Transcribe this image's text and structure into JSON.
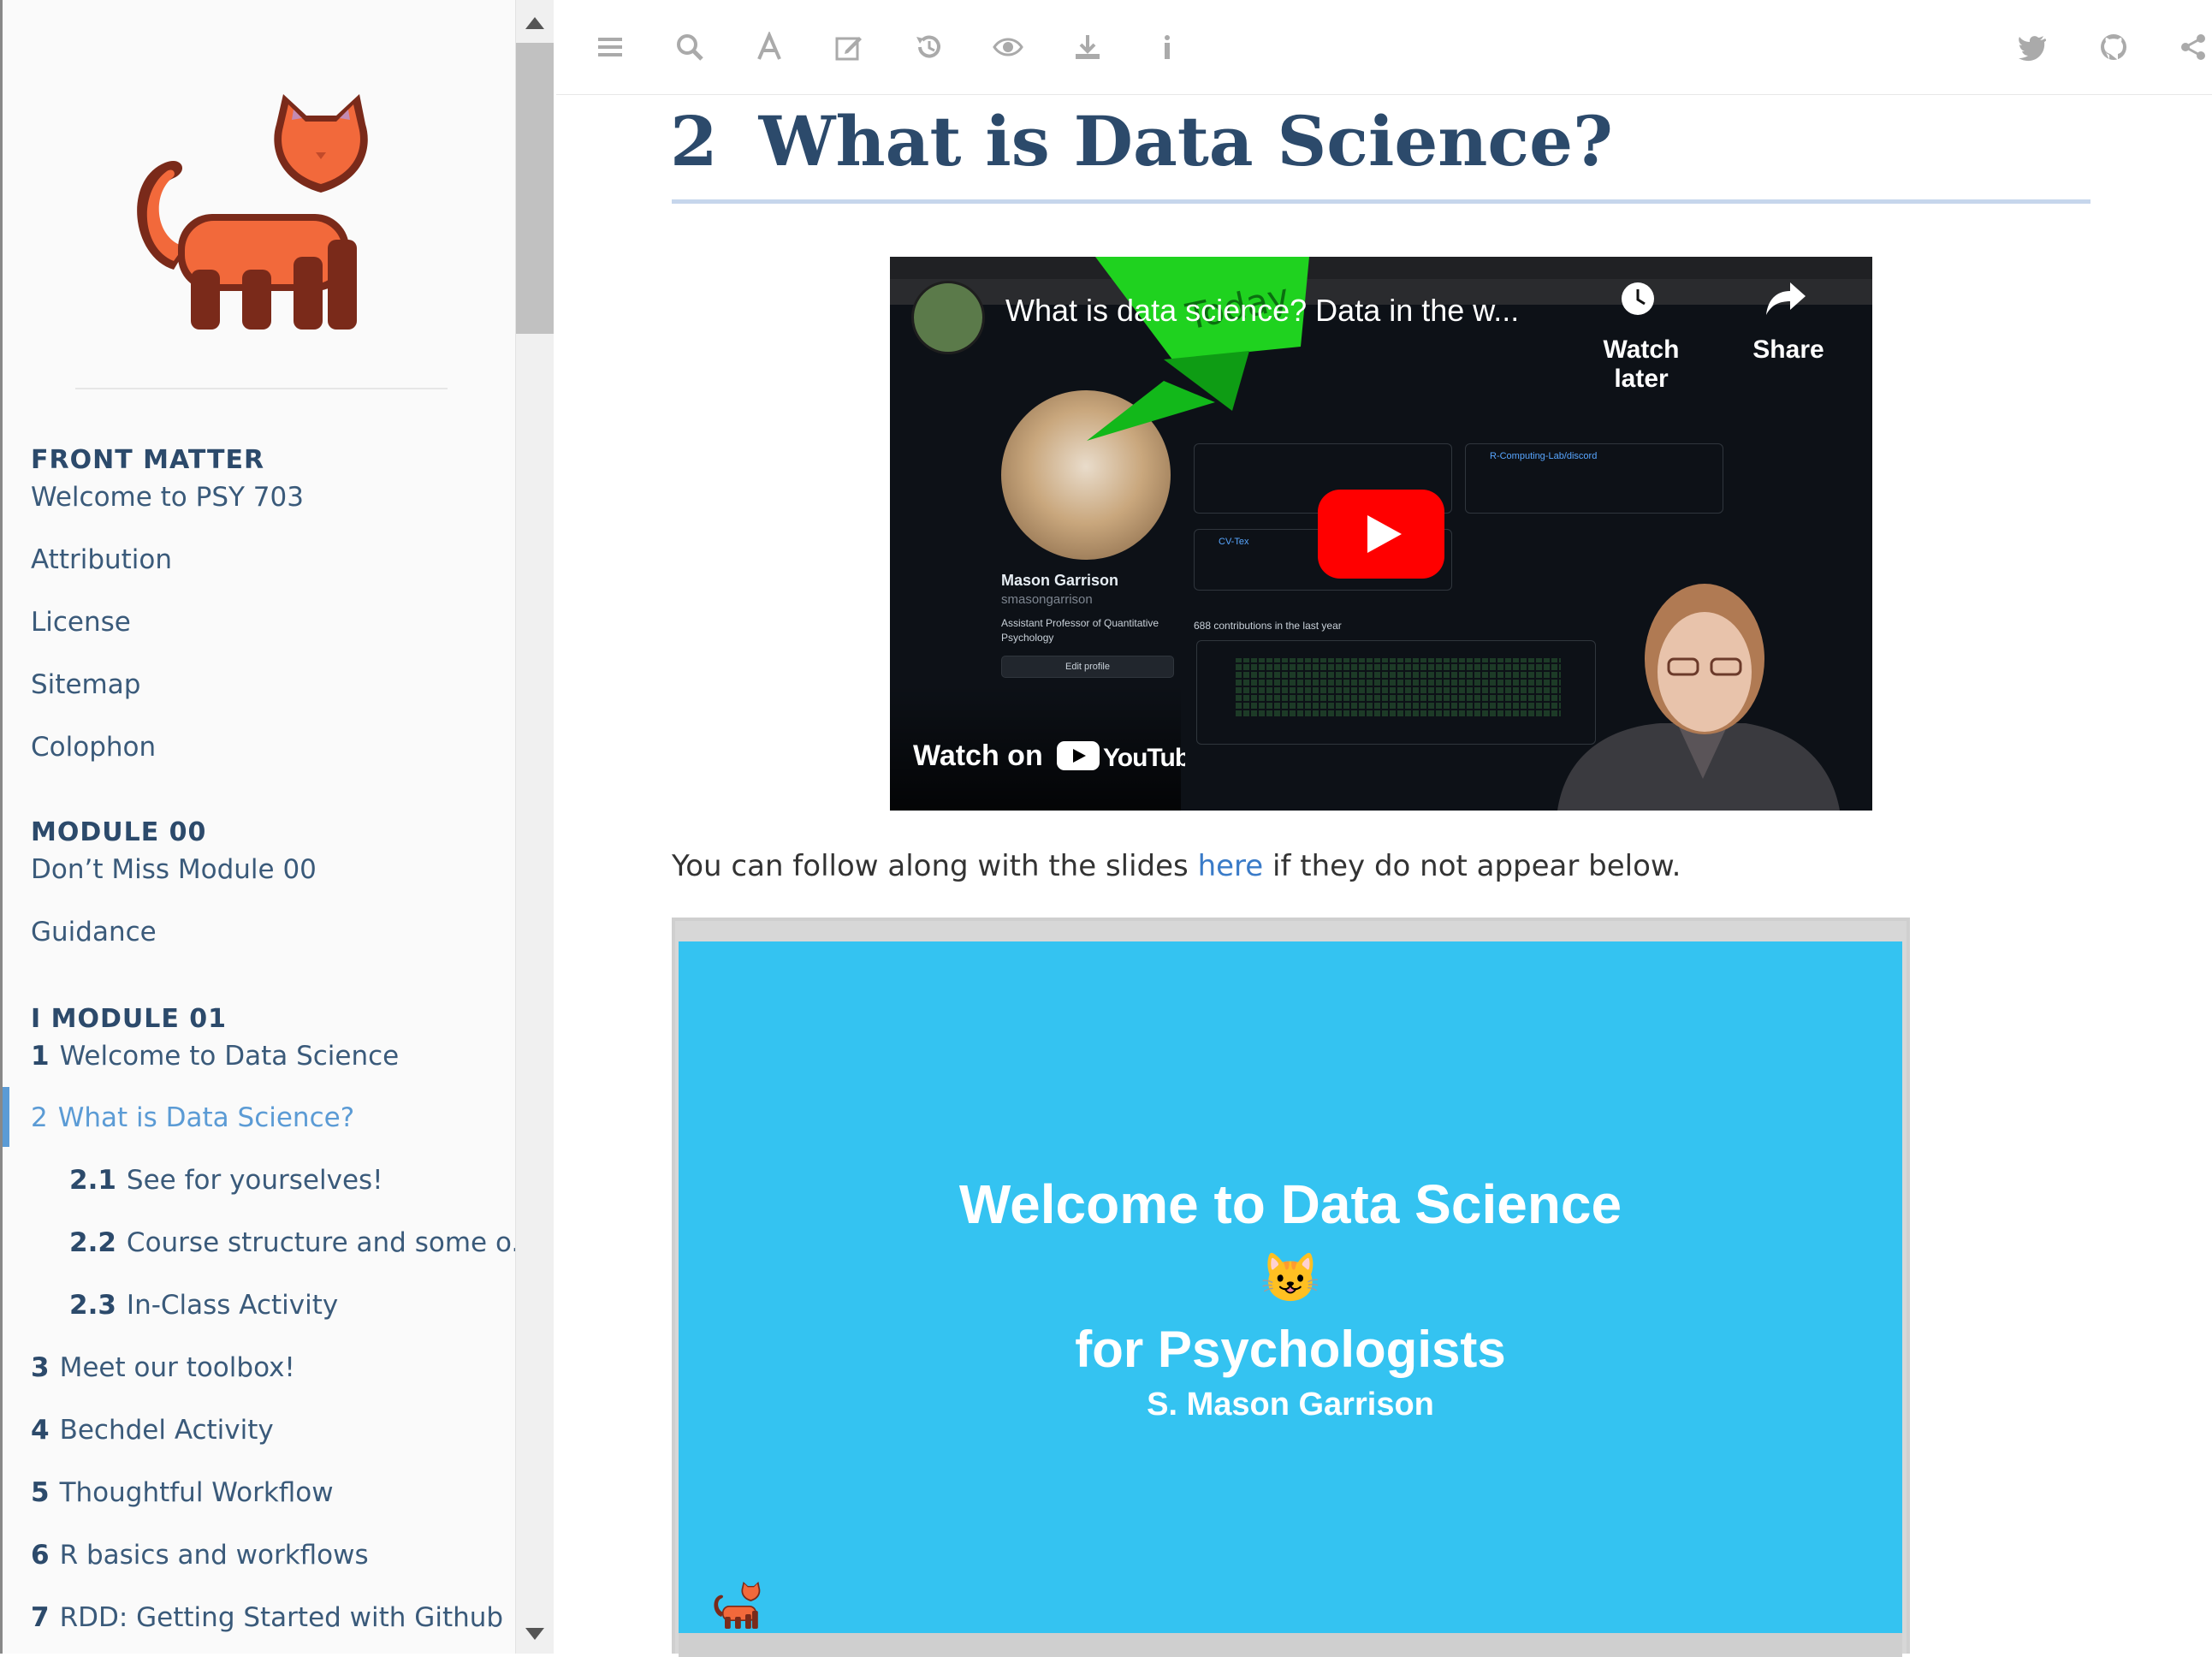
{
  "sidebar": {
    "groups": {
      "front_matter": "FRONT MATTER",
      "module00": "MODULE 00",
      "module01": "I MODULE 01"
    },
    "front_matter_items": [
      "Welcome to PSY 703",
      "Attribution",
      "License",
      "Sitemap",
      "Colophon"
    ],
    "module00_items": [
      "Don’t Miss Module 00",
      "Guidance"
    ],
    "module01_items": [
      {
        "num": "1",
        "label": "Welcome to Data Science"
      },
      {
        "num": "2",
        "label": "What is Data Science?"
      },
      {
        "num": "2.1",
        "label": "See for yourselves!"
      },
      {
        "num": "2.2",
        "label": "Course structure and some o..."
      },
      {
        "num": "2.3",
        "label": "In-Class Activity"
      },
      {
        "num": "3",
        "label": "Meet our toolbox!"
      },
      {
        "num": "4",
        "label": "Bechdel Activity"
      },
      {
        "num": "5",
        "label": "Thoughtful Workflow"
      },
      {
        "num": "6",
        "label": "R basics and workflows"
      },
      {
        "num": "7",
        "label": "RDD: Getting Started with Github"
      }
    ]
  },
  "toolbar": {
    "left_icons": [
      "menu-icon",
      "search-icon",
      "font-icon",
      "edit-icon",
      "history-icon",
      "eye-icon",
      "download-icon",
      "info-icon"
    ],
    "right_icons": [
      "twitter-icon",
      "github-icon",
      "share-icon"
    ]
  },
  "main": {
    "title_num": "2",
    "title": "What is Data Science?",
    "follow_before": "You can follow along with the slides ",
    "follow_link": "here",
    "follow_after": " if they do not appear below."
  },
  "video": {
    "title": "What is data science? Data in the w...",
    "watch_later": "Watch later",
    "share": "Share",
    "watch_on": "Watch on",
    "youtube": "YouTube",
    "flag_text": "Today",
    "gh_name": "Mason Garrison",
    "gh_handle": "smasongarrison",
    "gh_bio": "Assistant Professor of Quantitative Psychology",
    "gh_edit": "Edit profile",
    "gh_contrib": "688 contributions in the last year",
    "gh_repo1": "R-Computing-Lab/discord",
    "gh_repo2": "CV-Tex"
  },
  "slides": {
    "title": "Welcome to Data Science",
    "emoji": "😺",
    "subtitle": "for Psychologists",
    "author": "S. Mason Garrison"
  },
  "colors": {
    "accent": "#5b9bd5",
    "heading": "#2c4a6b",
    "slide_bg": "#34c3f1",
    "cat": "#f2693b"
  }
}
